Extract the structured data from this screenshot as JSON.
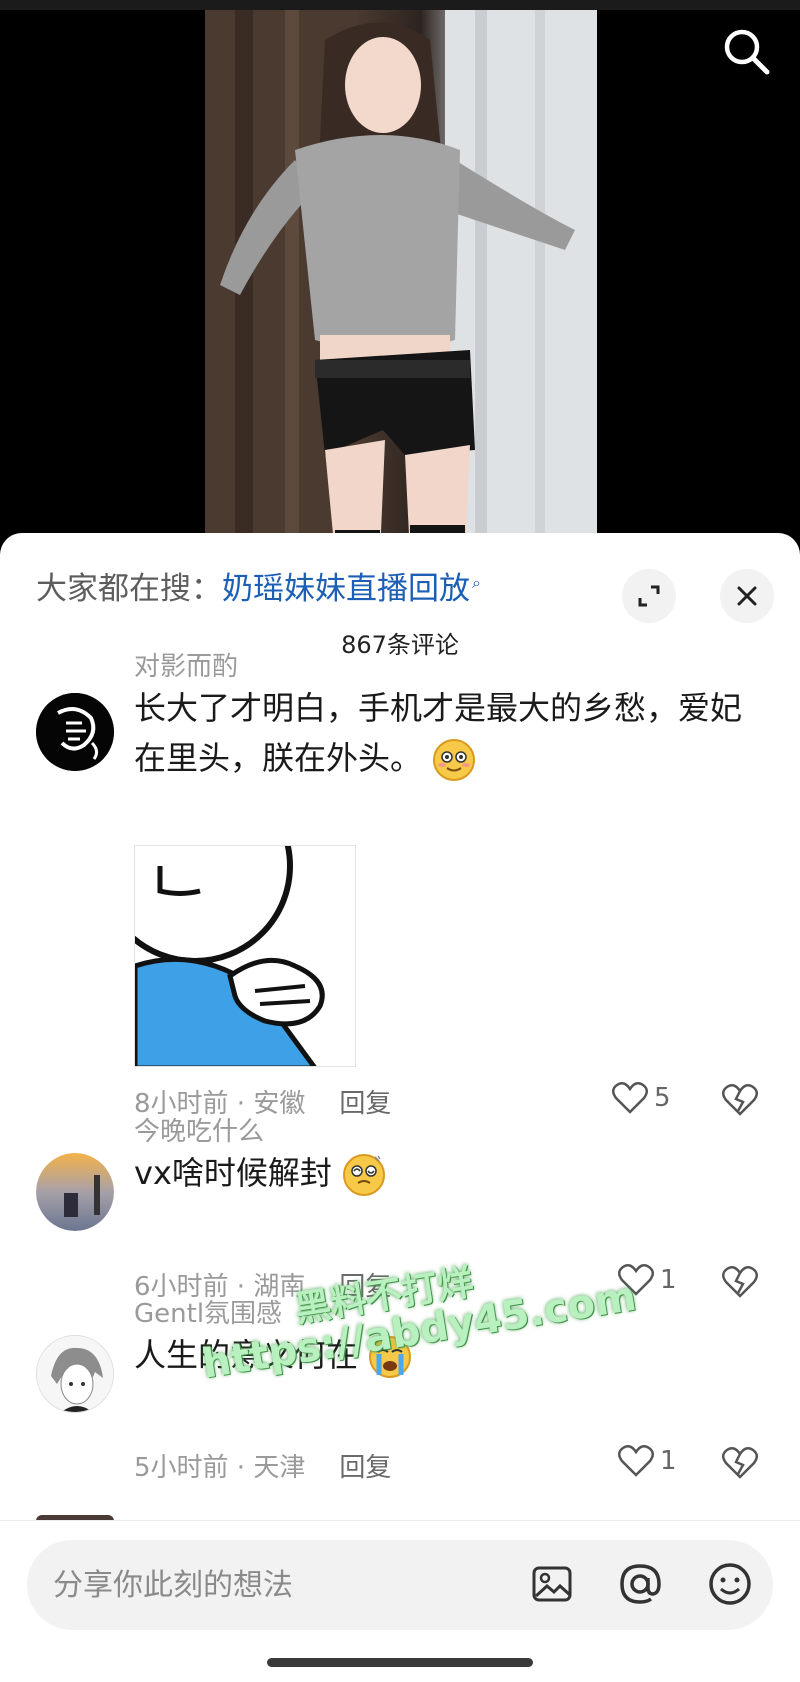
{
  "colors": {
    "accent_link": "#1c5fb5",
    "muted_text": "#9a9a9a",
    "sheet_bg": "#ffffff",
    "input_bg": "#f2f2f2"
  },
  "video": {
    "search_icon": "search-icon"
  },
  "header": {
    "hot_search_prefix": "大家都在搜：",
    "hot_search_term": "奶瑶妹妹直播回放",
    "expand_icon": "expand-icon",
    "close_icon": "close-icon"
  },
  "comment_count": "867条评论",
  "comments": [
    {
      "user": "对影而酌",
      "text": "长大了才明白，手机才是最大的乡愁，爱妃在里头，朕在外头。",
      "emoji": "flushed-face",
      "has_sticker": true,
      "time": "8小时前",
      "location": "安徽",
      "reply_label": "回复",
      "likes": "5"
    },
    {
      "user": "今晚吃什么",
      "text": "vx啥时候解封",
      "emoji": "dizzy-face",
      "time": "6小时前",
      "location": "湖南",
      "reply_label": "回复",
      "likes": "1"
    },
    {
      "user": "Gentl氛围感",
      "text": "人生的意义何在",
      "emoji": "crying-face",
      "time": "5小时前",
      "location": "天津",
      "reply_label": "回复",
      "likes": "1"
    }
  ],
  "meta_separator": " · ",
  "input": {
    "placeholder": "分享你此刻的想法",
    "image_icon": "image-icon",
    "mention_icon": "at-mention-icon",
    "emoji_icon": "emoji-icon"
  },
  "watermark": {
    "line1": "黑料不打烊",
    "line2": "https://abdy45.com"
  }
}
